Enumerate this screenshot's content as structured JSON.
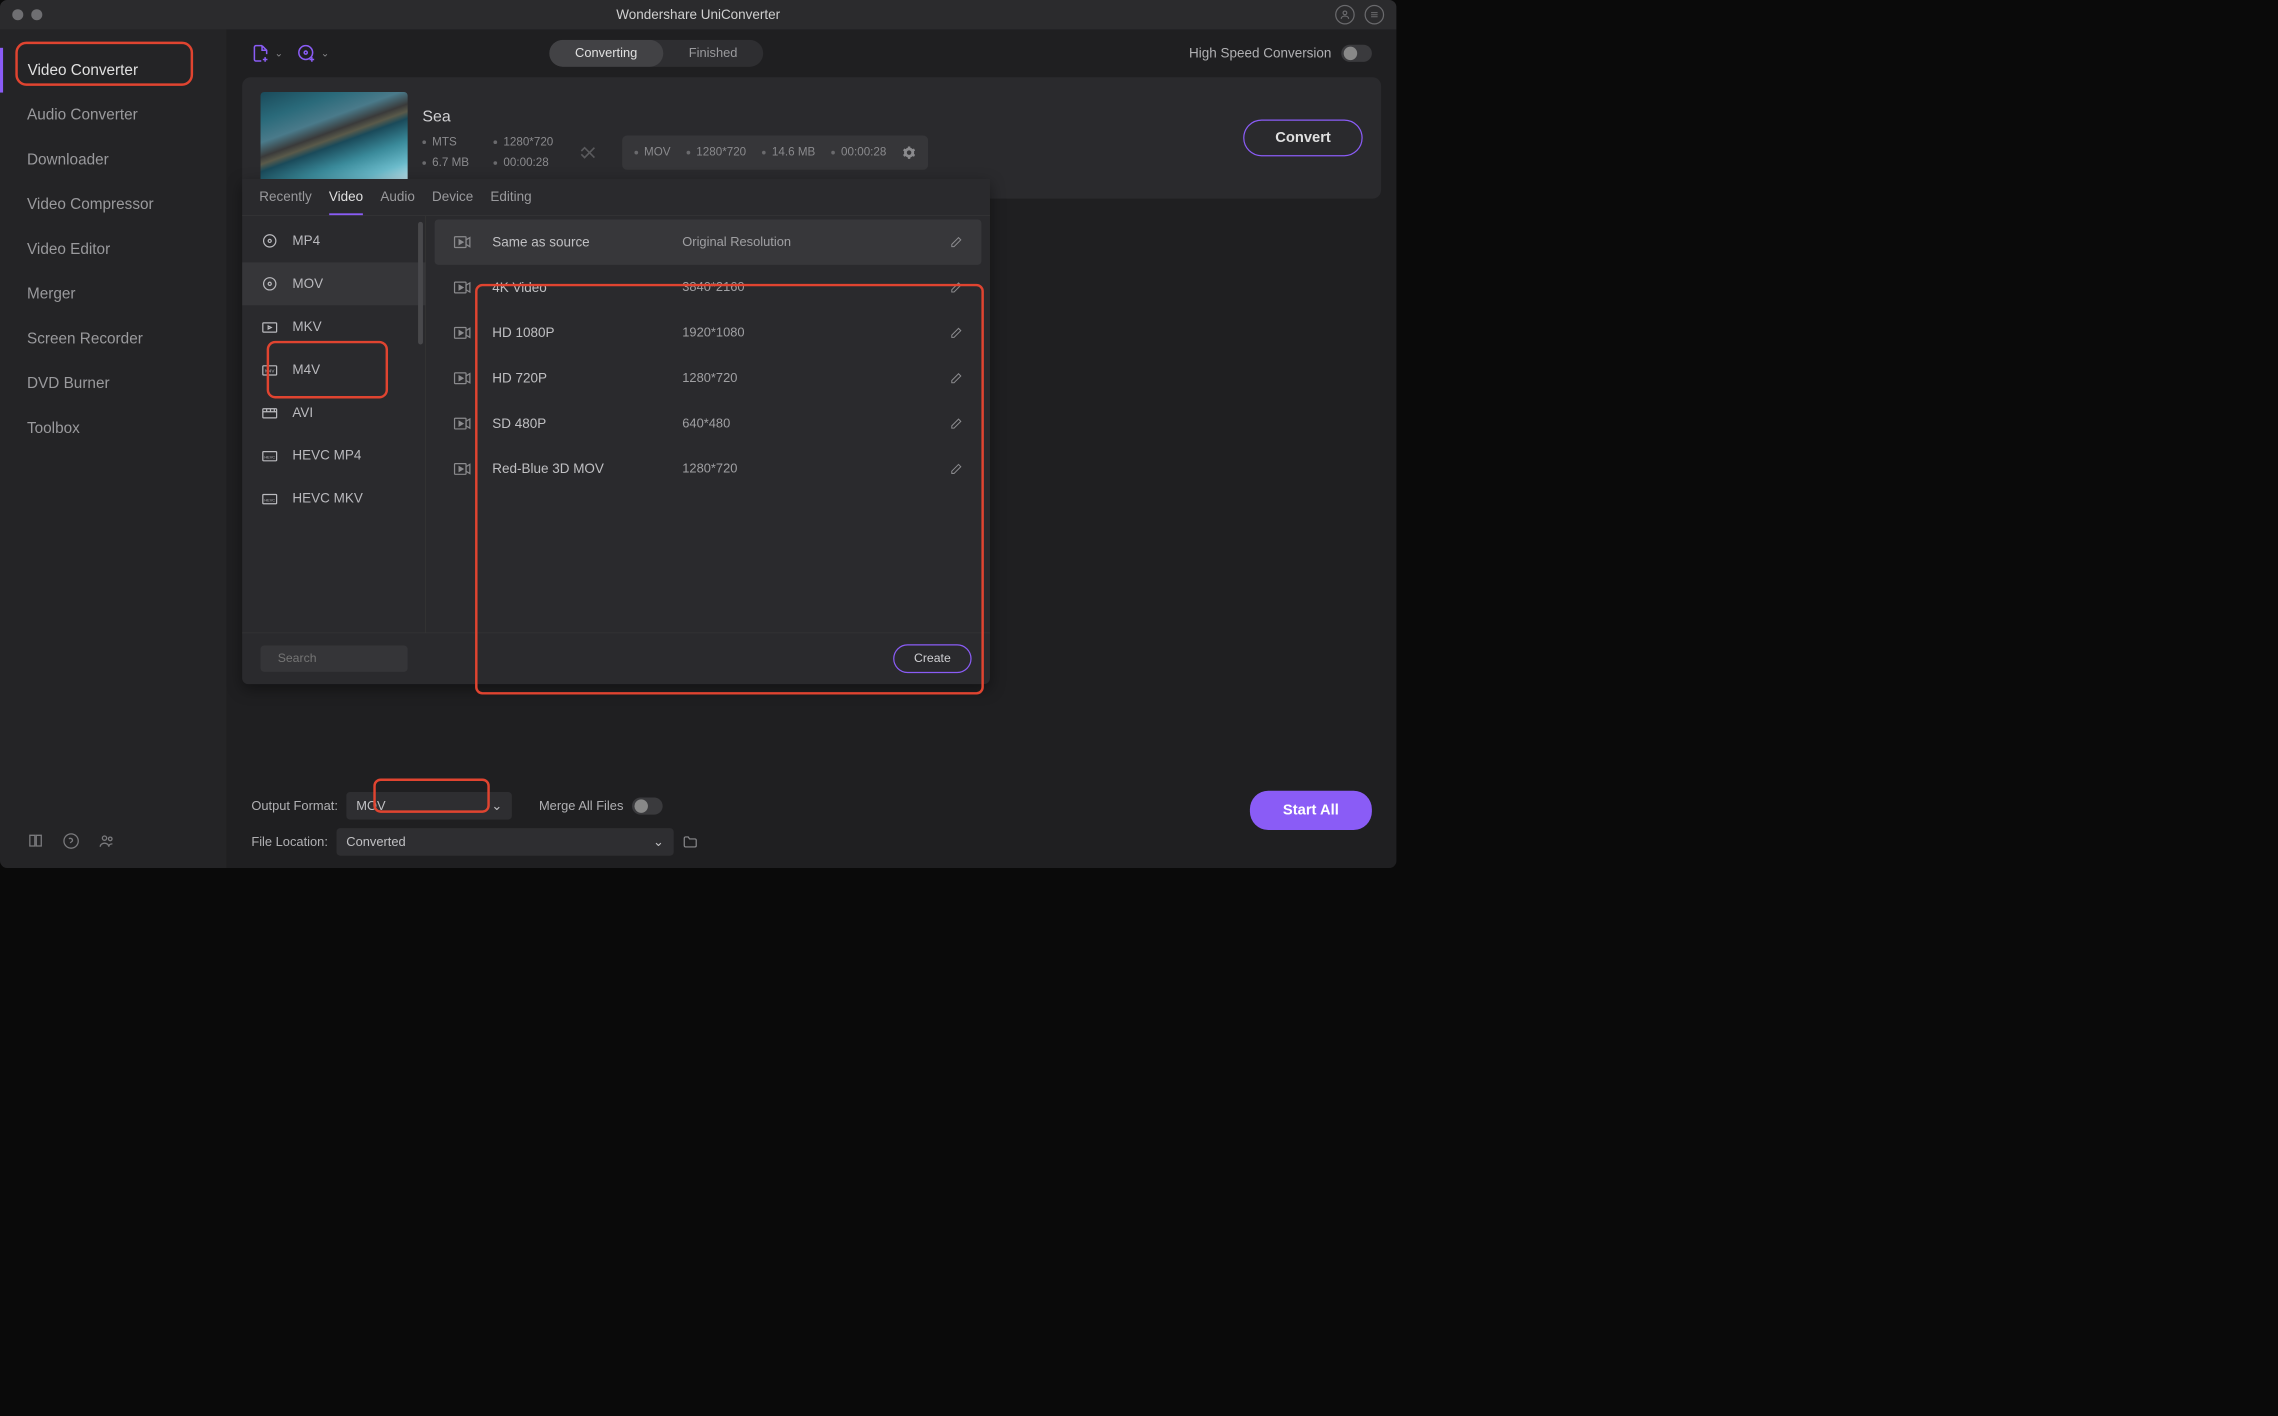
{
  "title": "Wondershare UniConverter",
  "sidebar": {
    "items": [
      {
        "label": "Video Converter",
        "active": true
      },
      {
        "label": "Audio Converter"
      },
      {
        "label": "Downloader"
      },
      {
        "label": "Video Compressor"
      },
      {
        "label": "Video Editor"
      },
      {
        "label": "Merger"
      },
      {
        "label": "Screen Recorder"
      },
      {
        "label": "DVD Burner"
      },
      {
        "label": "Toolbox"
      }
    ]
  },
  "toolbar": {
    "segments": [
      {
        "label": "Converting",
        "active": true
      },
      {
        "label": "Finished"
      }
    ],
    "hs_label": "High Speed Conversion"
  },
  "file": {
    "name": "Sea",
    "src": {
      "format": "MTS",
      "res": "1280*720",
      "size": "6.7 MB",
      "dur": "00:00:28"
    },
    "out": {
      "format": "MOV",
      "res": "1280*720",
      "size": "14.6 MB",
      "dur": "00:00:28"
    },
    "convert_label": "Convert"
  },
  "format_panel": {
    "tabs": [
      {
        "label": "Recently"
      },
      {
        "label": "Video",
        "active": true
      },
      {
        "label": "Audio"
      },
      {
        "label": "Device"
      },
      {
        "label": "Editing"
      }
    ],
    "formats": [
      {
        "label": "MP4"
      },
      {
        "label": "MOV",
        "active": true
      },
      {
        "label": "MKV"
      },
      {
        "label": "M4V"
      },
      {
        "label": "AVI"
      },
      {
        "label": "HEVC MP4"
      },
      {
        "label": "HEVC MKV"
      }
    ],
    "presets": [
      {
        "name": "Same as source",
        "res": "Original Resolution",
        "active": true
      },
      {
        "name": "4K Video",
        "res": "3840*2160"
      },
      {
        "name": "HD 1080P",
        "res": "1920*1080"
      },
      {
        "name": "HD 720P",
        "res": "1280*720"
      },
      {
        "name": "SD 480P",
        "res": "640*480"
      },
      {
        "name": "Red-Blue 3D MOV",
        "res": "1280*720"
      }
    ],
    "search_placeholder": "Search",
    "create_label": "Create"
  },
  "bottom": {
    "output_format_label": "Output Format:",
    "output_format_value": "MOV",
    "merge_label": "Merge All Files",
    "file_loc_label": "File Location:",
    "file_loc_value": "Converted",
    "start_all_label": "Start All"
  }
}
